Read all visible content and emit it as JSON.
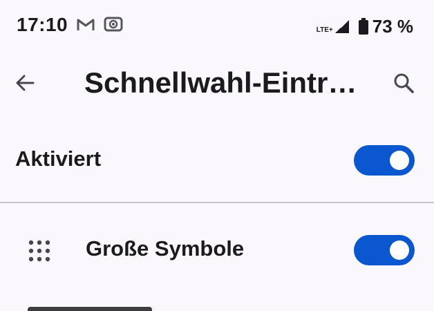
{
  "status_bar": {
    "time": "17:10",
    "network_type": "LTE+",
    "battery_percent": "73 %",
    "icons": [
      "gmail-icon",
      "cast-icon",
      "signal-icon",
      "battery-icon"
    ]
  },
  "app_bar": {
    "title": "Schnellwahl-Eintr…",
    "back_icon": "arrow-back-icon",
    "search_icon": "search-icon"
  },
  "settings": {
    "activated": {
      "label": "Aktiviert",
      "enabled": true
    },
    "big_icons": {
      "label": "Große Symbole",
      "icon": "dialpad-icon",
      "enabled": true
    }
  },
  "colors": {
    "accent": "#0b57cf",
    "background": "#fbf8fd",
    "text": "#1b1b1f",
    "divider": "#c7c5cc"
  }
}
